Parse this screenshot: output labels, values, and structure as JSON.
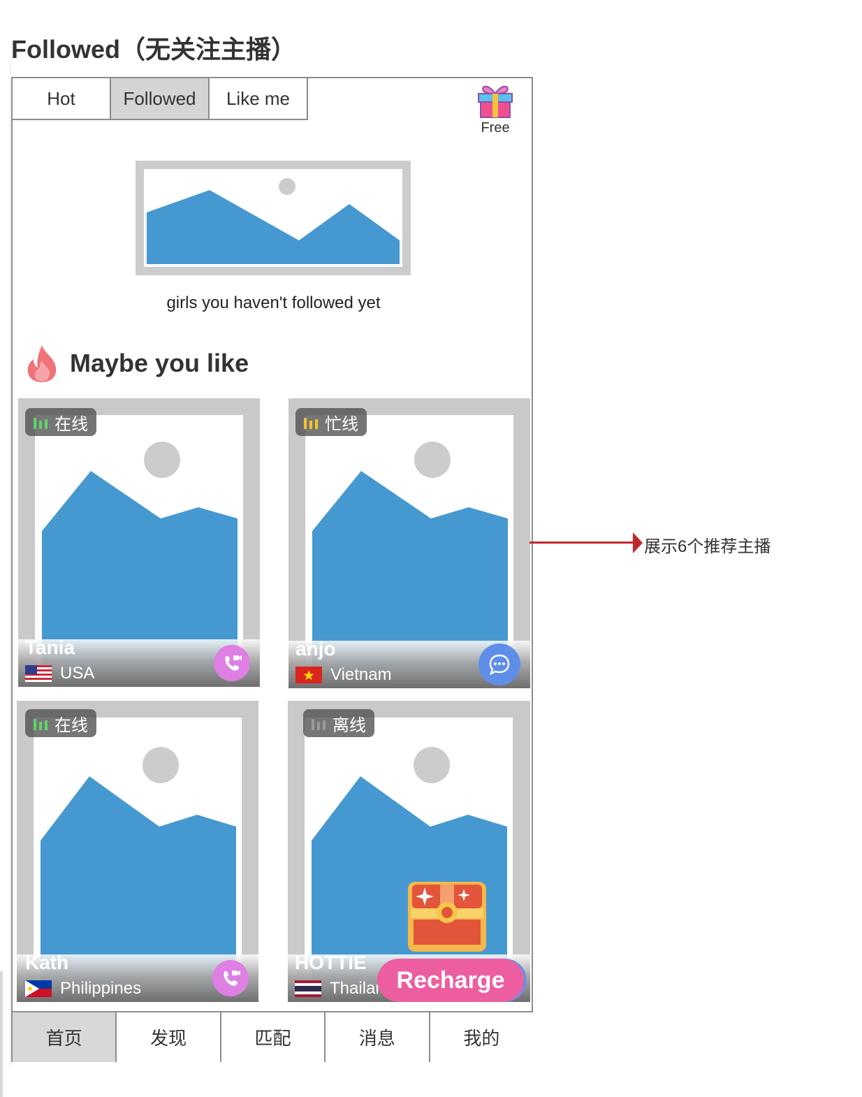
{
  "page_title": "Followed（无关注主播）",
  "tabs": [
    {
      "label": "Hot",
      "active": false
    },
    {
      "label": "Followed",
      "active": true
    },
    {
      "label": "Like me",
      "active": false
    }
  ],
  "gift": {
    "label": "Free",
    "icon": "gift-icon"
  },
  "empty_state": {
    "message": "girls you haven't followed yet",
    "icon": "image-placeholder-icon"
  },
  "section": {
    "title": "Maybe you like",
    "icon": "fire-icon"
  },
  "cards": [
    {
      "name": "Tania",
      "country": "USA",
      "status": "在线",
      "status_color": "#5fd36b",
      "action": "video-call-icon",
      "action_color": "#de7fe3"
    },
    {
      "name": "anjo",
      "country": "Vietnam",
      "status": "忙线",
      "status_color": "#f2c230",
      "action": "chat-icon",
      "action_color": "#5e8ee8"
    },
    {
      "name": "Kath",
      "country": "Philippines",
      "status": "在线",
      "status_color": "#5fd36b",
      "action": "video-call-icon",
      "action_color": "#de7fe3"
    },
    {
      "name": "HOTTIE",
      "country": "Thailand",
      "status": "离线",
      "status_color": "#9a9a9a",
      "action": "",
      "action_color": ""
    }
  ],
  "recharge": {
    "label": "Recharge",
    "icon": "treasure-chest-icon",
    "color": "#ec5ea0"
  },
  "bottom_nav": [
    {
      "label": "首页",
      "active": true
    },
    {
      "label": "发现",
      "active": false
    },
    {
      "label": "匹配",
      "active": false
    },
    {
      "label": "消息",
      "active": false
    },
    {
      "label": "我的",
      "active": false
    }
  ],
  "annotation": {
    "text": "展示6个推荐主播",
    "color": "#c0282d"
  },
  "colors": {
    "placeholder_blue": "#4699d0",
    "placeholder_gray": "#cccccc",
    "border": "#8c8c8c"
  }
}
